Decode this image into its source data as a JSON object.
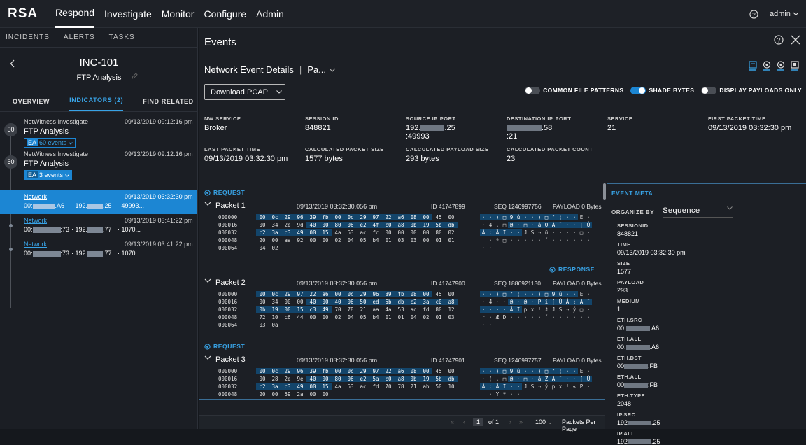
{
  "nav": {
    "logo": "RSA",
    "items": [
      "Respond",
      "Investigate",
      "Monitor",
      "Configure",
      "Admin"
    ],
    "user": "admin"
  },
  "left": {
    "subtabs": [
      "INCIDENTS",
      "ALERTS",
      "TASKS"
    ],
    "incident_id": "INC-101",
    "incident_name": "FTP Analysis",
    "tabs": [
      "OVERVIEW",
      "INDICATORS (2)",
      "FIND RELATED"
    ],
    "indicators": [
      {
        "source": "NetWitness Investigate",
        "time": "09/13/2019 09:12:16 pm",
        "score": "50",
        "title": "FTP Analysis",
        "chip_prefix": "EA",
        "chip": "60 events"
      },
      {
        "source": "NetWitness Investigate",
        "time": "09/13/2019 09:12:16 pm",
        "score": "50",
        "title": "FTP Analysis",
        "chip_prefix": "EA",
        "chip": "3 events"
      }
    ],
    "events": [
      {
        "type": "Network",
        "time": "09/13/2019 03:32:30 pm",
        "c1a": "00:",
        "c1b": ".A6",
        "c2a": "· 192.",
        "c2b": ".25",
        "c3": "· 49993..."
      },
      {
        "type": "Network",
        "time": "09/13/2019 03:41:22 pm",
        "c1a": "00:",
        "c1b": ":73",
        "c2a": "· 192.",
        "c2b": ".77",
        "c3": "· 1070..."
      },
      {
        "type": "Network",
        "time": "09/13/2019 03:41:22 pm",
        "c1a": "00:",
        "c1b": ":73",
        "c2a": "· 192.",
        "c2b": ".77",
        "c3": "· 1070..."
      }
    ]
  },
  "main": {
    "title": "Events",
    "details_title": "Network Event Details",
    "details_sep": "|",
    "details_view": "Pa...",
    "download_label": "Download PCAP",
    "toggles": [
      {
        "label": "COMMON FILE PATTERNS",
        "on": false
      },
      {
        "label": "SHADE BYTES",
        "on": true
      },
      {
        "label": "DISPLAY PAYLOADS ONLY",
        "on": false
      }
    ],
    "summary": [
      {
        "k": "NW SERVICE",
        "v": "Broker"
      },
      {
        "k": "SESSION ID",
        "v": "848821"
      },
      {
        "k": "SOURCE IP:PORT",
        "v": "192.",
        "v2": ".25",
        "v3": ":49993"
      },
      {
        "k": "DESTINATION IP:PORT",
        "v": "",
        "v2": ".58",
        "v3": ":21"
      },
      {
        "k": "SERVICE",
        "v": "21"
      },
      {
        "k": "FIRST PACKET TIME",
        "v": "09/13/2019 03:32:30 pm"
      },
      {
        "k": "LAST PACKET TIME",
        "v": "09/13/2019 03:32:30 pm"
      },
      {
        "k": "CALCULATED PACKET SIZE",
        "v": "1577 bytes"
      },
      {
        "k": "CALCULATED PAYLOAD SIZE",
        "v": "293 bytes"
      },
      {
        "k": "CALCULATED PACKET COUNT",
        "v": "23"
      }
    ],
    "packets": [
      {
        "dir": "REQUEST",
        "dir_side": "left",
        "name": "Packet 1",
        "time": "09/13/2019 03:32:30.056 pm",
        "id": "ID 41747899",
        "seq": "SEQ 1246997756",
        "payload": "PAYLOAD 0 Bytes",
        "rows": [
          {
            "off": "000000",
            "bytes": [
              "00",
              "0c",
              "29",
              "96",
              "39",
              "fb",
              "00",
              "0c",
              "29",
              "97",
              "22",
              "a6",
              "08",
              "00",
              "45",
              "00"
            ],
            "asc": [
              "·",
              "·",
              ")",
              "□",
              "9",
              "û",
              "·",
              "·",
              ")",
              "□",
              "\"",
              "¦",
              "·",
              "·",
              "E",
              "·"
            ],
            "shade": 14
          },
          {
            "off": "000016",
            "bytes": [
              "00",
              "34",
              "2e",
              "9d",
              "40",
              "00",
              "80",
              "06",
              "e2",
              "4f",
              "c0",
              "a8",
              "0b",
              "19",
              "5b",
              "db"
            ],
            "asc": [
              "·",
              "4",
              ".",
              "□",
              "@",
              "·",
              "□",
              "·",
              "â",
              "O",
              "À",
              "¨",
              "·",
              "·",
              "[",
              "Û"
            ],
            "shade_from": 4
          },
          {
            "off": "000032",
            "bytes": [
              "c2",
              "3a",
              "c3",
              "49",
              "00",
              "15",
              "4a",
              "53",
              "ac",
              "fc",
              "00",
              "00",
              "00",
              "00",
              "80",
              "02"
            ],
            "asc": [
              "Â",
              ":",
              "Ã",
              "I",
              "·",
              "·",
              "J",
              "S",
              "¬",
              "ü",
              "·",
              "·",
              "·",
              "·",
              "□",
              "·"
            ],
            "shade": 6
          },
          {
            "off": "000048",
            "bytes": [
              "20",
              "00",
              "aa",
              "92",
              "00",
              "00",
              "02",
              "04",
              "05",
              "b4",
              "01",
              "03",
              "03",
              "00",
              "01",
              "01"
            ],
            "asc": [
              " ",
              "·",
              "ª",
              "□",
              "·",
              "·",
              "·",
              "·",
              "·",
              "´",
              "·",
              "·",
              "·",
              "·",
              "·",
              "·"
            ],
            "shade": 0
          },
          {
            "off": "000064",
            "bytes": [
              "04",
              "02"
            ],
            "asc": [
              "·",
              "·"
            ],
            "shade": 0
          }
        ]
      },
      {
        "dir": "RESPONSE",
        "dir_side": "right",
        "name": "Packet 2",
        "time": "09/13/2019 03:32:30.056 pm",
        "id": "ID 41747900",
        "seq": "SEQ 1886921130",
        "payload": "PAYLOAD 0 Bytes",
        "rows": [
          {
            "off": "000000",
            "bytes": [
              "00",
              "0c",
              "29",
              "97",
              "22",
              "a6",
              "00",
              "0c",
              "29",
              "96",
              "39",
              "fb",
              "08",
              "00",
              "45",
              "00"
            ],
            "asc": [
              "·",
              "·",
              ")",
              "□",
              "\"",
              "¦",
              "·",
              "·",
              ")",
              "□",
              "9",
              "û",
              "·",
              "·",
              "E",
              "·"
            ],
            "shade": 14
          },
          {
            "off": "000016",
            "bytes": [
              "00",
              "34",
              "00",
              "00",
              "40",
              "00",
              "40",
              "06",
              "50",
              "ed",
              "5b",
              "db",
              "c2",
              "3a",
              "c0",
              "a8"
            ],
            "asc": [
              "·",
              "4",
              "·",
              "·",
              "@",
              "·",
              "@",
              "·",
              "P",
              "í",
              "[",
              "Û",
              "Â",
              ":",
              "À",
              "¨"
            ],
            "shade_from": 4
          },
          {
            "off": "000032",
            "bytes": [
              "0b",
              "19",
              "00",
              "15",
              "c3",
              "49",
              "70",
              "78",
              "21",
              "aa",
              "4a",
              "53",
              "ac",
              "fd",
              "80",
              "12"
            ],
            "asc": [
              "·",
              "·",
              "·",
              "·",
              "Ã",
              "I",
              "p",
              "x",
              "!",
              "ª",
              "J",
              "S",
              "¬",
              "ý",
              "□",
              "·"
            ],
            "shade": 6
          },
          {
            "off": "000048",
            "bytes": [
              "72",
              "10",
              "c6",
              "44",
              "00",
              "00",
              "02",
              "04",
              "05",
              "b4",
              "01",
              "01",
              "04",
              "02",
              "01",
              "03"
            ],
            "asc": [
              "r",
              "·",
              "Æ",
              "D",
              "·",
              "·",
              "·",
              "·",
              "·",
              "´",
              "·",
              "·",
              "·",
              "·",
              "·",
              "·"
            ],
            "shade": 0
          },
          {
            "off": "000064",
            "bytes": [
              "03",
              "0a"
            ],
            "asc": [
              "·",
              "·"
            ],
            "shade": 0
          }
        ]
      },
      {
        "dir": "REQUEST",
        "dir_side": "left",
        "name": "Packet 3",
        "time": "09/13/2019 03:32:30.056 pm",
        "id": "ID 41747901",
        "seq": "SEQ 1246997757",
        "payload": "PAYLOAD 0 Bytes",
        "rows": [
          {
            "off": "000000",
            "bytes": [
              "00",
              "0c",
              "29",
              "96",
              "39",
              "fb",
              "00",
              "0c",
              "29",
              "97",
              "22",
              "a6",
              "08",
              "00",
              "45",
              "00"
            ],
            "asc": [
              "·",
              "·",
              ")",
              "□",
              "9",
              "û",
              "·",
              "·",
              ")",
              "□",
              "\"",
              "¦",
              "·",
              "·",
              "E",
              "·"
            ],
            "shade": 14
          },
          {
            "off": "000016",
            "bytes": [
              "00",
              "28",
              "2e",
              "9e",
              "40",
              "00",
              "80",
              "06",
              "e2",
              "5a",
              "c0",
              "a8",
              "0b",
              "19",
              "5b",
              "db"
            ],
            "asc": [
              "·",
              "(",
              ".",
              "□",
              "@",
              "·",
              "□",
              "·",
              "â",
              "Z",
              "À",
              "¨",
              "·",
              "·",
              "[",
              "Û"
            ],
            "shade_from": 4
          },
          {
            "off": "000032",
            "bytes": [
              "c2",
              "3a",
              "c3",
              "49",
              "00",
              "15",
              "4a",
              "53",
              "ac",
              "fd",
              "70",
              "78",
              "21",
              "ab",
              "50",
              "10"
            ],
            "asc": [
              "Â",
              ":",
              "Ã",
              "I",
              "·",
              "·",
              "J",
              "S",
              "¬",
              "ý",
              "p",
              "x",
              "!",
              "«",
              "P",
              "·"
            ],
            "shade": 6
          },
          {
            "off": "000048",
            "bytes": [
              "20",
              "00",
              "59",
              "2a",
              "00",
              "00"
            ],
            "asc": [
              " ",
              "·",
              "Y",
              "*",
              "·",
              "·"
            ],
            "shade": 0
          }
        ]
      }
    ],
    "pager": {
      "current": "1",
      "of": "of 1",
      "size": "100",
      "label": "Packets Per Page"
    }
  },
  "meta": {
    "title": "EVENT META",
    "organize_label": "ORGANIZE BY",
    "organize_value": "Sequence",
    "items": [
      {
        "k": "SESSIONID",
        "v": "848821"
      },
      {
        "k": "TIME",
        "v": "09/13/2019 03:32:30 pm"
      },
      {
        "k": "SIZE",
        "v": "1577"
      },
      {
        "k": "PAYLOAD",
        "v": "293"
      },
      {
        "k": "MEDIUM",
        "v": "1"
      },
      {
        "k": "ETH.SRC",
        "v": "00:",
        "v2": ":A6"
      },
      {
        "k": "ETH.ALL",
        "v": "00:",
        "v2": ":A6"
      },
      {
        "k": "ETH.DST",
        "v": "00",
        "v2": ":FB"
      },
      {
        "k": "ETH.ALL",
        "v": "00",
        "v2": ":FB"
      },
      {
        "k": "ETH.TYPE",
        "v": "2048"
      },
      {
        "k": "IP.SRC",
        "v": "192",
        "v2": ".25"
      },
      {
        "k": "IP.ALL",
        "v": "192",
        "v2": ".25"
      }
    ]
  }
}
